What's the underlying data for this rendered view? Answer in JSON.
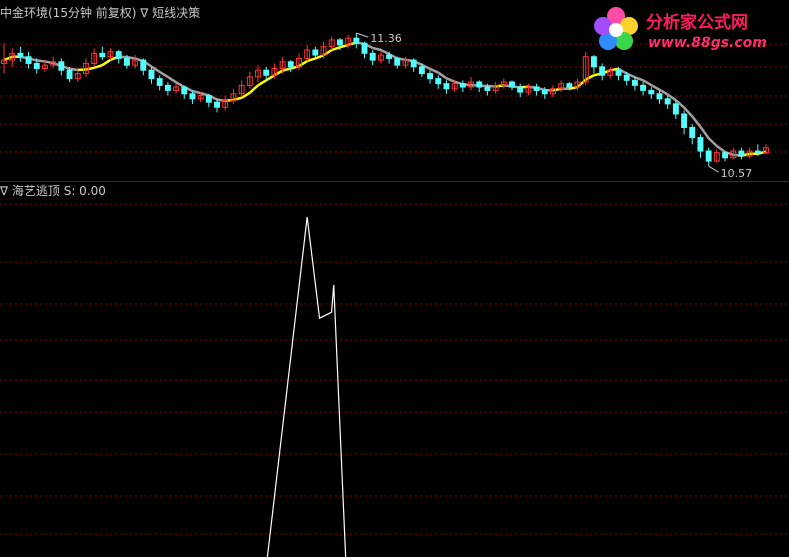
{
  "top_title": {
    "indicator": "中金环境(15分钟 前复权)",
    "marker": "∇",
    "formula": "短线决策"
  },
  "bottom_title": {
    "marker": "∇",
    "name": "海艺逃顶",
    "value_label": "S: 0.00"
  },
  "logo": {
    "name": "分析家公式网",
    "url": "www.88gs.com"
  },
  "colors": {
    "background": "#000000",
    "grid": "#8b0000",
    "up_candle": "#ff3333",
    "down_candle": "#54fcfc",
    "ma_gray": "#a0a0a0",
    "ma_yellow": "#ffff00",
    "signal_line": "#ffffff"
  },
  "chart_data": [
    {
      "type": "candlestick",
      "title": "中金环境(15分钟 前复权)",
      "annotations": [
        {
          "label": "11.36",
          "kind": "high"
        },
        {
          "label": "10.57",
          "kind": "low"
        }
      ],
      "ylim": [
        10.5,
        11.45
      ],
      "candles": [
        [
          11.18,
          11.2,
          11.3,
          11.12
        ],
        [
          11.2,
          11.24,
          11.27,
          11.16
        ],
        [
          11.24,
          11.22,
          11.28,
          11.19
        ],
        [
          11.22,
          11.18,
          11.25,
          11.15
        ],
        [
          11.18,
          11.15,
          11.21,
          11.12
        ],
        [
          11.15,
          11.17,
          11.2,
          11.13
        ],
        [
          11.17,
          11.19,
          11.22,
          11.15
        ],
        [
          11.19,
          11.14,
          11.21,
          11.11
        ],
        [
          11.14,
          11.09,
          11.16,
          11.07
        ],
        [
          11.09,
          11.12,
          11.15,
          11.07
        ],
        [
          11.12,
          11.18,
          11.21,
          11.1
        ],
        [
          11.18,
          11.24,
          11.27,
          11.16
        ],
        [
          11.24,
          11.22,
          11.28,
          11.2
        ],
        [
          11.22,
          11.25,
          11.27,
          11.2
        ],
        [
          11.25,
          11.21,
          11.26,
          11.18
        ],
        [
          11.21,
          11.17,
          11.23,
          11.15
        ],
        [
          11.17,
          11.2,
          11.23,
          11.15
        ],
        [
          11.2,
          11.14,
          11.21,
          11.11
        ],
        [
          11.14,
          11.09,
          11.16,
          11.06
        ],
        [
          11.09,
          11.05,
          11.11,
          11.02
        ],
        [
          11.05,
          11.02,
          11.07,
          10.99
        ],
        [
          11.02,
          11.04,
          11.06,
          11.0
        ],
        [
          11.04,
          11.0,
          11.05,
          10.97
        ],
        [
          11.0,
          10.97,
          11.02,
          10.94
        ],
        [
          10.97,
          10.99,
          11.01,
          10.95
        ],
        [
          10.99,
          10.95,
          11.0,
          10.92
        ],
        [
          10.95,
          10.92,
          10.97,
          10.89
        ],
        [
          10.92,
          10.96,
          10.99,
          10.9
        ],
        [
          10.96,
          11.0,
          11.03,
          10.94
        ],
        [
          11.0,
          11.05,
          11.08,
          10.98
        ],
        [
          11.05,
          11.1,
          11.13,
          11.03
        ],
        [
          11.1,
          11.14,
          11.17,
          11.07
        ],
        [
          11.14,
          11.11,
          11.16,
          11.08
        ],
        [
          11.11,
          11.15,
          11.18,
          11.09
        ],
        [
          11.15,
          11.19,
          11.22,
          11.12
        ],
        [
          11.19,
          11.16,
          11.2,
          11.13
        ],
        [
          11.16,
          11.21,
          11.24,
          11.14
        ],
        [
          11.21,
          11.26,
          11.29,
          11.19
        ],
        [
          11.26,
          11.23,
          11.28,
          11.21
        ],
        [
          11.23,
          11.28,
          11.31,
          11.21
        ],
        [
          11.28,
          11.32,
          11.34,
          11.26
        ],
        [
          11.32,
          11.29,
          11.33,
          11.26
        ],
        [
          11.29,
          11.33,
          11.35,
          11.27
        ],
        [
          11.33,
          11.3,
          11.36,
          11.27
        ],
        [
          11.3,
          11.24,
          11.31,
          11.21
        ],
        [
          11.24,
          11.2,
          11.26,
          11.17
        ],
        [
          11.2,
          11.23,
          11.25,
          11.18
        ],
        [
          11.23,
          11.21,
          11.25,
          11.18
        ],
        [
          11.21,
          11.17,
          11.22,
          11.15
        ],
        [
          11.17,
          11.2,
          11.22,
          11.15
        ],
        [
          11.2,
          11.16,
          11.21,
          11.13
        ],
        [
          11.16,
          11.12,
          11.18,
          11.1
        ],
        [
          11.12,
          11.09,
          11.14,
          11.06
        ],
        [
          11.09,
          11.06,
          11.11,
          11.03
        ],
        [
          11.06,
          11.03,
          11.08,
          11.0
        ],
        [
          11.03,
          11.06,
          11.08,
          11.01
        ],
        [
          11.06,
          11.04,
          11.08,
          11.01
        ],
        [
          11.04,
          11.07,
          11.1,
          11.02
        ],
        [
          11.07,
          11.04,
          11.08,
          11.01
        ],
        [
          11.04,
          11.02,
          11.06,
          10.99
        ],
        [
          11.02,
          11.05,
          11.07,
          11.0
        ],
        [
          11.05,
          11.07,
          11.09,
          11.03
        ],
        [
          11.07,
          11.04,
          11.08,
          11.02
        ],
        [
          11.04,
          11.01,
          11.06,
          10.98
        ],
        [
          11.01,
          11.04,
          11.06,
          10.99
        ],
        [
          11.04,
          11.02,
          11.06,
          10.99
        ],
        [
          11.02,
          11.0,
          11.04,
          10.97
        ],
        [
          11.0,
          11.03,
          11.05,
          10.98
        ],
        [
          11.03,
          11.06,
          11.08,
          11.01
        ],
        [
          11.06,
          11.04,
          11.07,
          11.02
        ],
        [
          11.04,
          11.07,
          11.09,
          11.02
        ],
        [
          11.07,
          11.22,
          11.25,
          11.05
        ],
        [
          11.22,
          11.16,
          11.23,
          11.12
        ],
        [
          11.16,
          11.11,
          11.18,
          11.08
        ],
        [
          11.11,
          11.14,
          11.16,
          11.09
        ],
        [
          11.14,
          11.11,
          11.16,
          11.08
        ],
        [
          11.11,
          11.08,
          11.13,
          11.05
        ],
        [
          11.08,
          11.05,
          11.1,
          11.02
        ],
        [
          11.05,
          11.02,
          11.07,
          10.99
        ],
        [
          11.02,
          11.0,
          11.04,
          10.97
        ],
        [
          11.0,
          10.97,
          11.02,
          10.94
        ],
        [
          10.97,
          10.94,
          10.99,
          10.91
        ],
        [
          10.94,
          10.88,
          10.96,
          10.85
        ],
        [
          10.88,
          10.8,
          10.9,
          10.76
        ],
        [
          10.8,
          10.74,
          10.82,
          10.7
        ],
        [
          10.74,
          10.66,
          10.76,
          10.62
        ],
        [
          10.66,
          10.6,
          10.68,
          10.57
        ],
        [
          10.6,
          10.65,
          10.67,
          10.59
        ],
        [
          10.65,
          10.62,
          10.66,
          10.6
        ],
        [
          10.62,
          10.66,
          10.68,
          10.61
        ],
        [
          10.66,
          10.63,
          10.68,
          10.61
        ],
        [
          10.63,
          10.66,
          10.68,
          10.62
        ],
        [
          10.66,
          10.65,
          10.7,
          10.63
        ],
        [
          10.65,
          10.68,
          10.7,
          10.64
        ]
      ]
    },
    {
      "type": "line",
      "title": "海艺逃顶",
      "series": [
        {
          "name": "S",
          "values": [
            0,
            0,
            0,
            0,
            0,
            0,
            0,
            0,
            0,
            0,
            0,
            0,
            0,
            0,
            0,
            0,
            0,
            0,
            0,
            0,
            0,
            0,
            0,
            0,
            0,
            0,
            0,
            0,
            0,
            0,
            0,
            0,
            0,
            0,
            0,
            0,
            0,
            0,
            0,
            0,
            0,
            0,
            0,
            0,
            0,
            0,
            0,
            0,
            0,
            0,
            0,
            0,
            0,
            0,
            0,
            0,
            0,
            0,
            0,
            0,
            0,
            0,
            0,
            0,
            0,
            0,
            0,
            0,
            0,
            0,
            0,
            0,
            0,
            0,
            0,
            0,
            0,
            0,
            0,
            0,
            0,
            0,
            0,
            0,
            0,
            0,
            0,
            0,
            0,
            0,
            0,
            0,
            0,
            0
          ]
        }
      ],
      "peaks": [
        {
          "bar": 37,
          "value": 1.0
        },
        {
          "bar": 39,
          "value": 0.72
        },
        {
          "bar": 40,
          "value": 0.8
        }
      ],
      "ylim": [
        0,
        1.05
      ]
    }
  ]
}
